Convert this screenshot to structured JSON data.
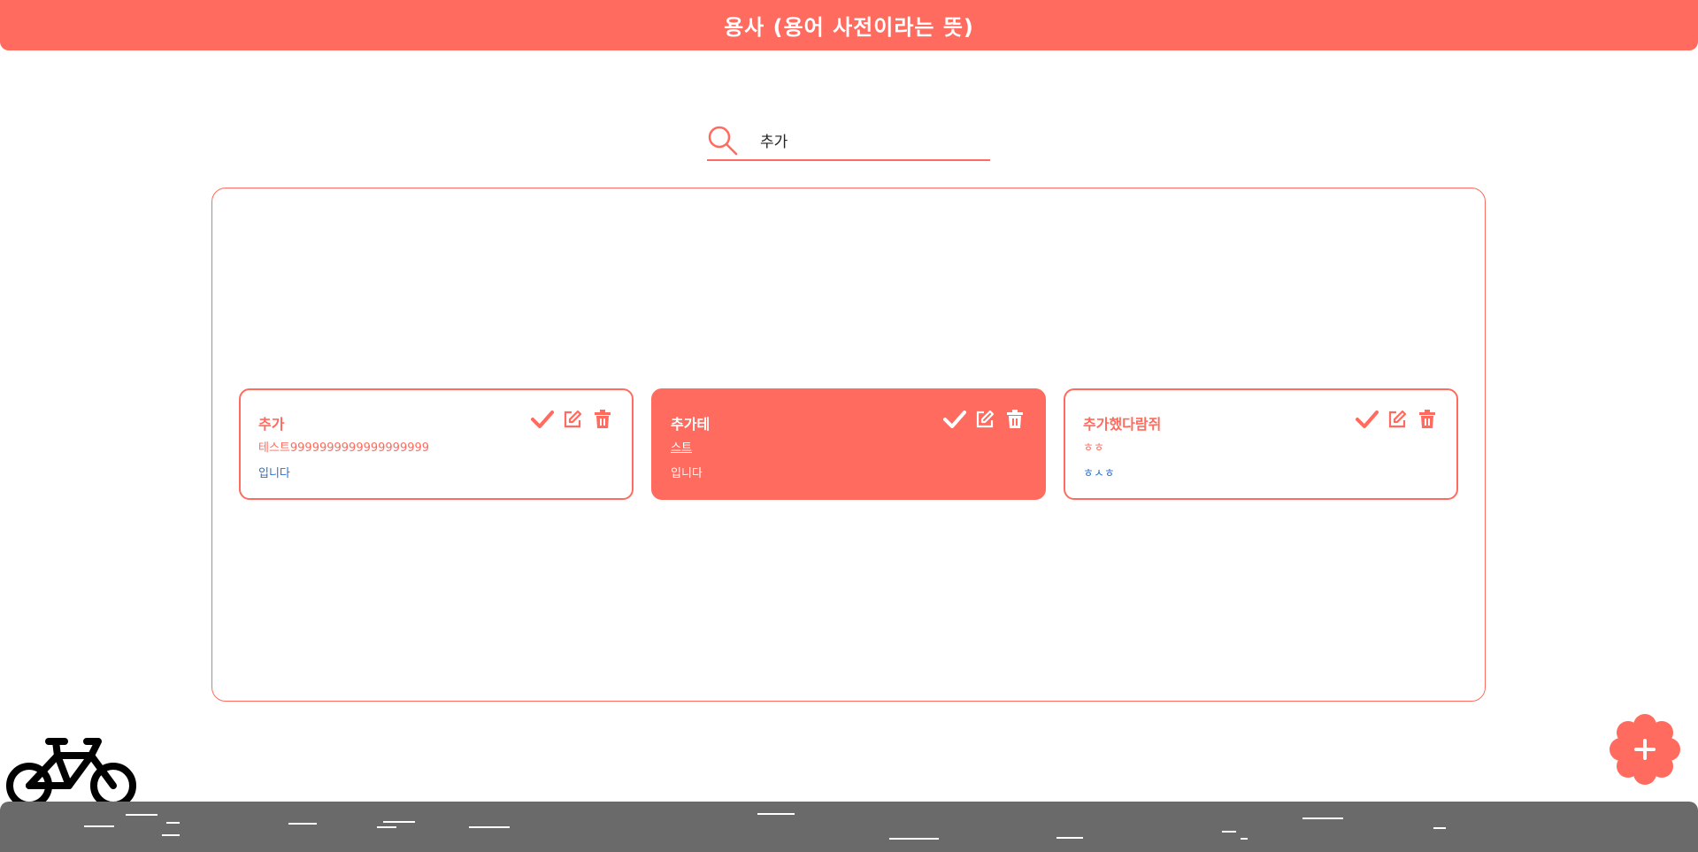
{
  "header": {
    "title": "용사 (용어 사전이라는 뜻)"
  },
  "search": {
    "value": "추가"
  },
  "cards": [
    {
      "word": "추가",
      "meaning": "테스트9999999999999999999",
      "example": "입니다",
      "active": false
    },
    {
      "word": "추가테",
      "meaning": "스트",
      "example": "입니다",
      "active": true
    },
    {
      "word": "추가했다람쥐",
      "meaning": "ㅎㅎ",
      "example": "ㅎㅅㅎ",
      "active": false
    }
  ],
  "colors": {
    "accent": "#ff6b5e",
    "footer": "#6a6a6a",
    "example_text": "#2a6fc9"
  },
  "icons": [
    "search-icon",
    "check-icon",
    "edit-icon",
    "trash-icon",
    "plus-icon",
    "bicycle-icon"
  ]
}
